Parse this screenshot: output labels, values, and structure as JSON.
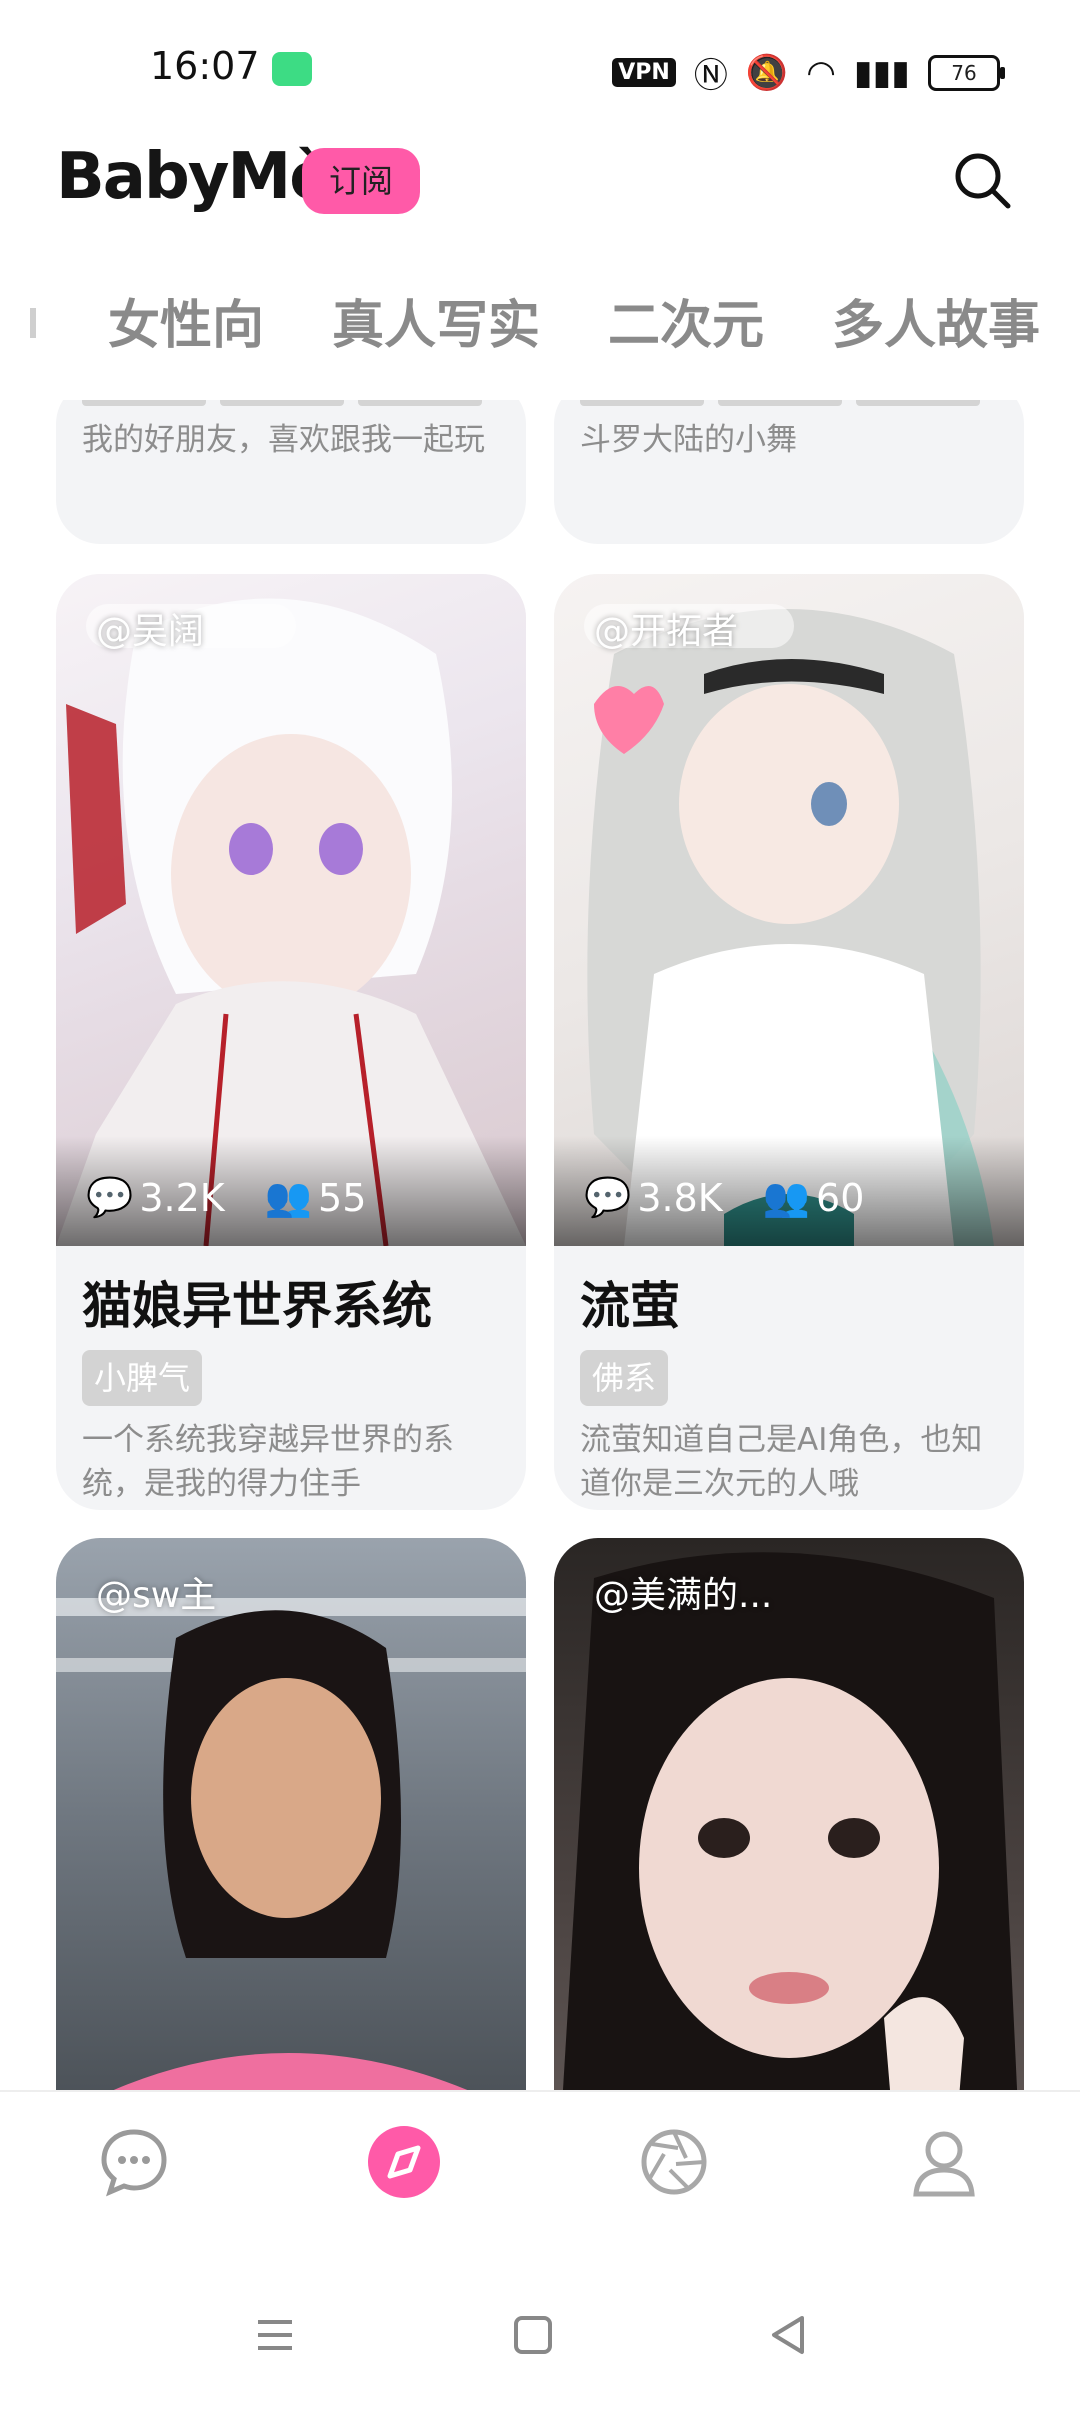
{
  "status": {
    "time": "16:07",
    "vpn": "VPN",
    "battery": "76"
  },
  "header": {
    "logo": "BabyMò",
    "subscribe": "订阅"
  },
  "tabs": [
    "女性向",
    "真人写实",
    "二次元",
    "多人故事"
  ],
  "partial_cards": [
    {
      "desc": "我的好朋友，喜欢跟我一起玩"
    },
    {
      "desc": "斗罗大陆的小舞"
    }
  ],
  "cards": [
    {
      "author": "@吴阔",
      "comments": "3.2K",
      "users": "55",
      "name": "猫娘异世界系统",
      "tag": "小脾气",
      "desc": "一个系统我穿越异世界的系统，是我的得力住手"
    },
    {
      "author": "@开拓者",
      "comments": "3.8K",
      "users": "60",
      "name": "流萤",
      "tag": "佛系",
      "desc": "流萤知道自己是AI角色，也知道你是三次元的人哦"
    },
    {
      "author": "@sw主"
    },
    {
      "author": "@美满的..."
    }
  ],
  "colors": {
    "accent": "#ff5aa8",
    "card_bg": "#f3f4f6",
    "tag_bg": "#d3d3d3"
  }
}
